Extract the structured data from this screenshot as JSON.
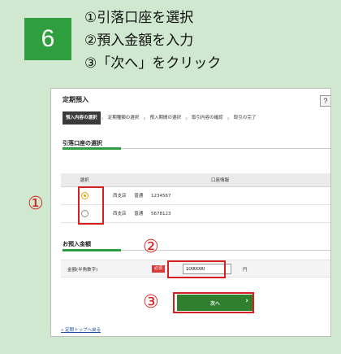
{
  "step": {
    "number": "6",
    "instructions": [
      "①引落口座を選択",
      "②預入金額を入力",
      "③「次へ」をクリック"
    ]
  },
  "page": {
    "title": "定期預入",
    "help": "?",
    "steps": [
      "預入内容の選択",
      "定期種類の選択",
      "預入期間の選択",
      "取引内容の確認",
      "取引の完了"
    ],
    "active_step_index": 0
  },
  "account_section": {
    "title": "引落口座の選択",
    "col_select": "選択",
    "col_info": "口座情報",
    "rows": [
      {
        "branch": "西支店",
        "type": "普通",
        "number": "1234567",
        "selected": true
      },
      {
        "branch": "西支店",
        "type": "普通",
        "number": "5678123",
        "selected": false
      }
    ]
  },
  "amount_section": {
    "title": "お預入金額",
    "label": "金額(半角数字)",
    "required": "必須",
    "value": "1000000",
    "unit": "円"
  },
  "next_button": {
    "label": "次へ"
  },
  "back_link": {
    "label": "定期トップへ戻る"
  },
  "annotations": [
    "①",
    "②",
    "③"
  ],
  "colors": {
    "accent": "#2f9e3f",
    "annotation": "#d81e1e",
    "radio_selected": "#e8a300"
  }
}
